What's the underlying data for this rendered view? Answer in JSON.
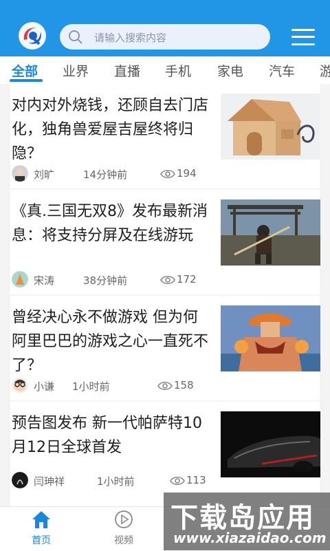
{
  "header": {
    "search_placeholder": "请输入搜索内容",
    "accent_color": "#2196e6"
  },
  "tabs": [
    {
      "label": "全部",
      "active": true
    },
    {
      "label": "业界"
    },
    {
      "label": "直播"
    },
    {
      "label": "手机"
    },
    {
      "label": "家电"
    },
    {
      "label": "汽车"
    },
    {
      "label": "游"
    }
  ],
  "articles": [
    {
      "title": "对内对外烧钱，还顾自去门店化，独角兽爱屋吉屋终将归隐？",
      "author": "刘旷",
      "time": "14分钟前",
      "views": "194",
      "thumb_icon": "wooden-house-image"
    },
    {
      "title": "《真.三国无双8》发布最新消息：将支持分屏及在线游玩",
      "author": "宋涛",
      "time": "38分钟前",
      "views": "172",
      "thumb_icon": "game-warrior-image"
    },
    {
      "title": "曾经决心永不做游戏 但为何阿里巴巴的游戏之心一直死不了？",
      "author": "小谦",
      "time": "1小时前",
      "views": "158",
      "thumb_icon": "anime-character-image"
    },
    {
      "title": " 预告图发布 新一代帕萨特10月12日全球首发",
      "author": "闫珅祥",
      "time": "1小时前",
      "views": "113",
      "thumb_icon": "dark-car-image"
    }
  ],
  "bottom_nav": {
    "home_label": "首页",
    "video_label": "视频"
  },
  "watermark": {
    "main": "下载岛应用",
    "url": "www.xiazaidao.com"
  }
}
